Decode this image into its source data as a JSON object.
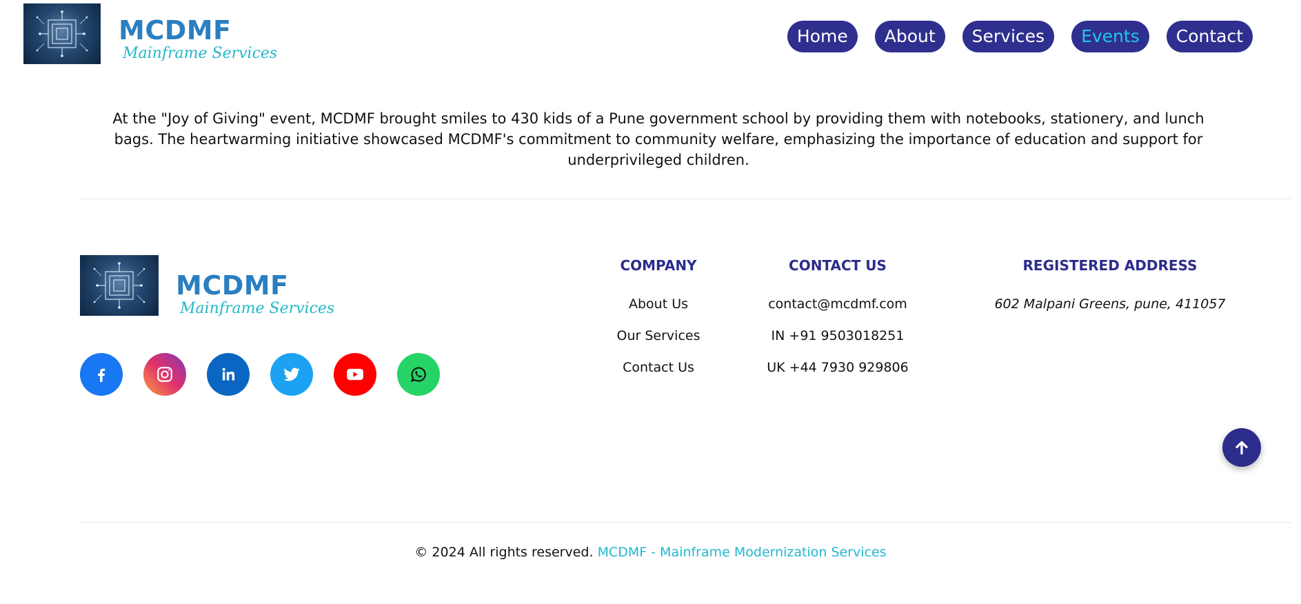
{
  "header": {
    "brand_title": "MCDMF",
    "brand_subtitle": "Mainframe Services",
    "nav": [
      {
        "label": "Home"
      },
      {
        "label": "About"
      },
      {
        "label": "Services"
      },
      {
        "label": "Events",
        "active": true
      },
      {
        "label": "Contact"
      }
    ]
  },
  "event": {
    "description": "At the \"Joy of Giving\" event, MCDMF brought smiles to 430 kids of a Pune government school by providing them with notebooks, stationery, and lunch bags. The heartwarming initiative showcased MCDMF's commitment to community welfare, emphasizing the importance of education and support for underprivileged children."
  },
  "footer": {
    "brand_title": "MCDMF",
    "brand_subtitle": "Mainframe Services",
    "socials": [
      {
        "name": "facebook-icon",
        "color": "#1877f2"
      },
      {
        "name": "instagram-icon",
        "color": "#c13584"
      },
      {
        "name": "linkedin-icon",
        "color": "#0a66c2"
      },
      {
        "name": "twitter-icon",
        "color": "#1da1f2"
      },
      {
        "name": "youtube-icon",
        "color": "#ff0000"
      },
      {
        "name": "whatsapp-icon",
        "color": "#25d366"
      }
    ],
    "company": {
      "heading": "COMPANY",
      "items": [
        "About Us",
        "Our Services",
        "Contact Us"
      ]
    },
    "contact": {
      "heading": "CONTACT US",
      "items": [
        "contact@mcdmf.com",
        "IN +91 9503018251",
        "UK +44 7930 929806"
      ]
    },
    "address": {
      "heading": "REGISTERED ADDRESS",
      "text": "602 Malpani Greens, pune, 411057"
    },
    "copyright_text": "© 2024 All rights reserved.",
    "copyright_link": "MCDMF - Mainframe Modernization Services"
  },
  "colors": {
    "nav_bg": "#2f2f8f",
    "nav_active_text": "#22c8e8",
    "brand_blue": "#2a7fc0",
    "brand_cyan": "#23b8c8",
    "heading_navy": "#2c2c8c"
  }
}
